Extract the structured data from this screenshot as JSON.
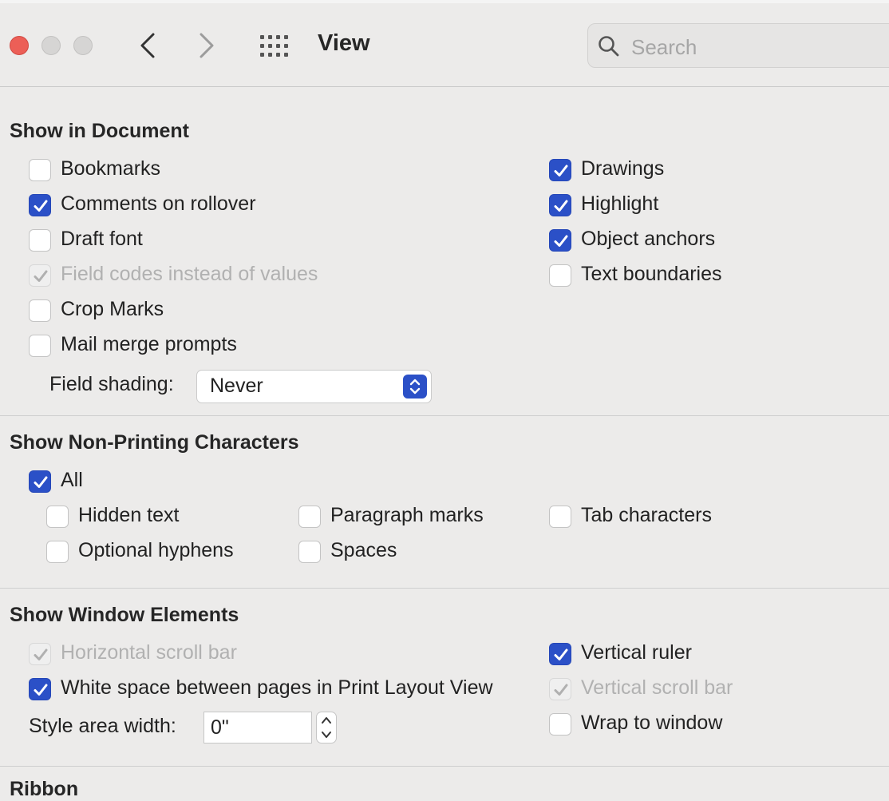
{
  "window": {
    "title": "View",
    "search_placeholder": "Search"
  },
  "show_in_document": {
    "heading": "Show in Document",
    "left": [
      {
        "label": "Bookmarks",
        "checked": false,
        "disabled": false
      },
      {
        "label": "Comments on rollover",
        "checked": true,
        "disabled": false
      },
      {
        "label": "Draft font",
        "checked": false,
        "disabled": false
      },
      {
        "label": "Field codes instead of values",
        "checked": true,
        "disabled": true
      },
      {
        "label": "Crop Marks",
        "checked": false,
        "disabled": false
      },
      {
        "label": "Mail merge prompts",
        "checked": false,
        "disabled": false
      }
    ],
    "right": [
      {
        "label": "Drawings",
        "checked": true,
        "disabled": false
      },
      {
        "label": "Highlight",
        "checked": true,
        "disabled": false
      },
      {
        "label": "Object anchors",
        "checked": true,
        "disabled": false
      },
      {
        "label": "Text boundaries",
        "checked": false,
        "disabled": false
      }
    ],
    "field_shading": {
      "label": "Field shading:",
      "value": "Never"
    }
  },
  "non_printing": {
    "heading": "Show Non-Printing Characters",
    "all": {
      "label": "All",
      "checked": true,
      "disabled": false
    },
    "items": [
      {
        "label": "Hidden text",
        "checked": false,
        "disabled": false
      },
      {
        "label": "Paragraph marks",
        "checked": false,
        "disabled": false
      },
      {
        "label": "Tab characters",
        "checked": false,
        "disabled": false
      },
      {
        "label": "Optional hyphens",
        "checked": false,
        "disabled": false
      },
      {
        "label": "Spaces",
        "checked": false,
        "disabled": false
      }
    ]
  },
  "window_elements": {
    "heading": "Show Window Elements",
    "left": [
      {
        "label": "Horizontal scroll bar",
        "checked": true,
        "disabled": true
      },
      {
        "label": "White space between pages in Print Layout View",
        "checked": true,
        "disabled": false
      }
    ],
    "right": [
      {
        "label": "Vertical ruler",
        "checked": true,
        "disabled": false
      },
      {
        "label": "Vertical scroll bar",
        "checked": true,
        "disabled": true
      },
      {
        "label": "Wrap to window",
        "checked": false,
        "disabled": false
      }
    ],
    "style_area": {
      "label": "Style area width:",
      "value": "0\""
    }
  },
  "next_section": {
    "heading": "Ribbon"
  },
  "colors": {
    "accent": "#2b50c7",
    "close": "#ec5f57"
  }
}
